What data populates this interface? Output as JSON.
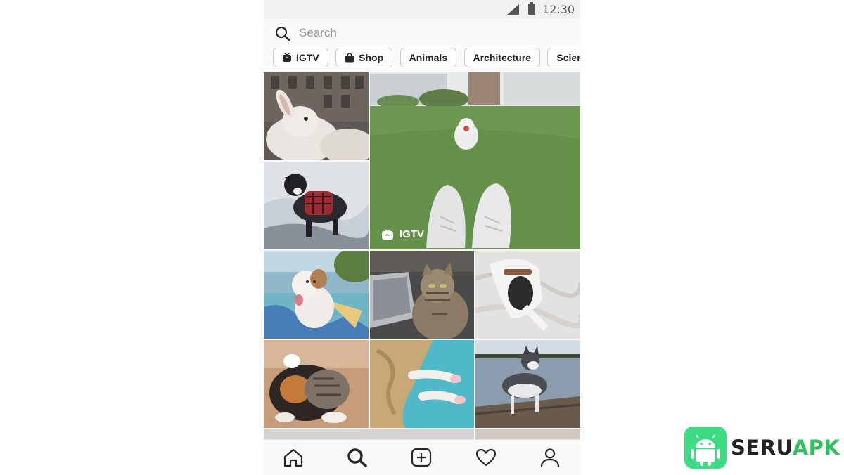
{
  "status_bar": {
    "time": "12:30"
  },
  "search": {
    "placeholder": "Search",
    "value": ""
  },
  "chips": [
    {
      "label": "IGTV",
      "icon": "igtv-icon"
    },
    {
      "label": "Shop",
      "icon": "shop-bag-icon"
    },
    {
      "label": "Animals",
      "icon": ""
    },
    {
      "label": "Architecture",
      "icon": ""
    },
    {
      "label": "Science &",
      "icon": ""
    }
  ],
  "grid": {
    "tiles": [
      {
        "subject": "rabbit"
      },
      {
        "subject": "dog in park",
        "badge": "IGTV"
      },
      {
        "subject": "dog in snow"
      },
      {
        "subject": "pit bull on painted ground"
      },
      {
        "subject": "tabby cat with laptop"
      },
      {
        "subject": "dog on blanket"
      },
      {
        "subject": "cats cuddling"
      },
      {
        "subject": "cat paws on blanket"
      },
      {
        "subject": "husky by water"
      }
    ]
  },
  "bottom_nav": [
    "home-icon",
    "search-icon",
    "add-post-icon",
    "heart-icon",
    "profile-icon"
  ],
  "watermark": {
    "part1": "SERU",
    "part2": "APK"
  },
  "colors": {
    "accent_green": "#3ddc84",
    "brand_green": "#2ec05a",
    "text": "#262626"
  }
}
